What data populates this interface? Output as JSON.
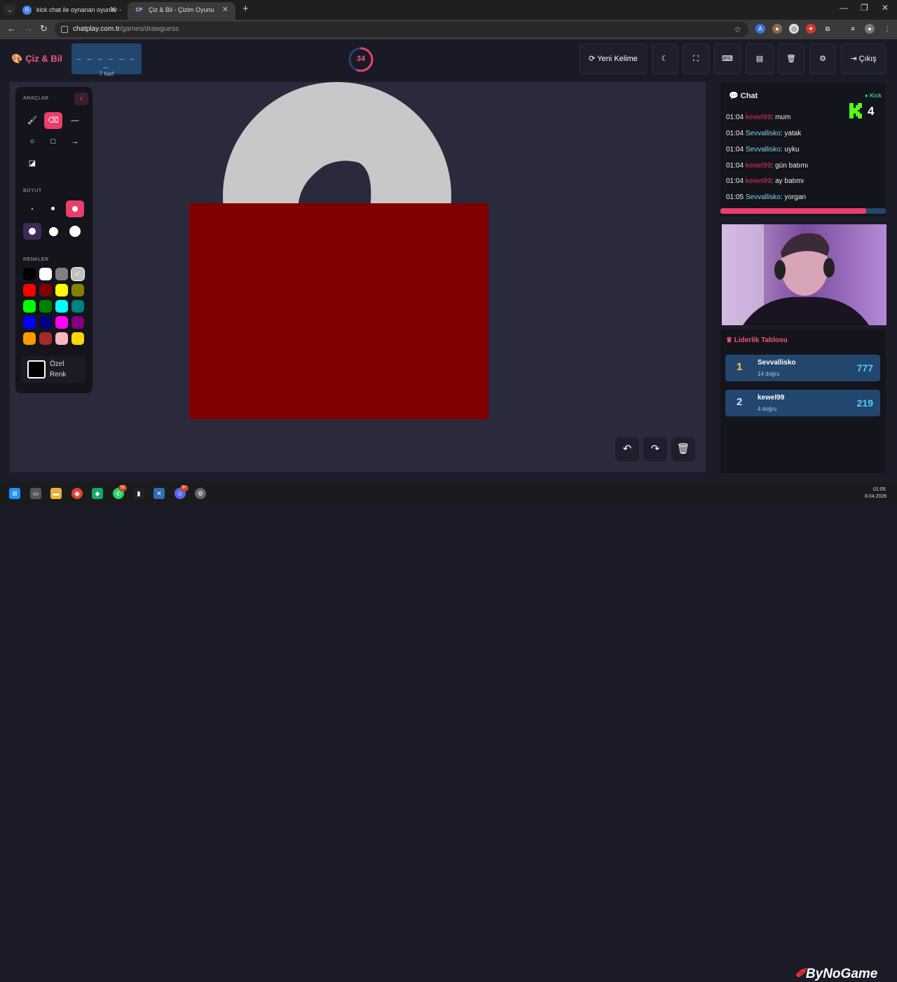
{
  "browser": {
    "tabs": [
      {
        "title": "kick chat ile oynanan oyunlar -",
        "close": "✕"
      },
      {
        "title": "Çiz & Bil - Çizim Oyunu",
        "close": "✕",
        "favicon": "CP"
      }
    ],
    "new_tab": "+",
    "window_controls": [
      "—",
      "❐",
      "✕"
    ],
    "url_host": "chatplay.com.tr",
    "url_path": "/games/drawguess"
  },
  "header": {
    "brand": "Çiz & Bil",
    "word_mask": "_ _ _ _ _ _ _",
    "word_length": "7 harf",
    "timer": "34",
    "timer_progress": 0.55,
    "new_word_label": "Yeni Kelime",
    "exit_label": "Çıkış"
  },
  "tools": {
    "section_tools": "ARAÇLAR",
    "section_size": "BOYUT",
    "section_colors": "RENKLER",
    "custom_color_label": "Özel Renk",
    "palette": [
      "#000000",
      "#ffffff",
      "#808080",
      "#c0c0c0",
      "#ff0000",
      "#800000",
      "#ffff00",
      "#808000",
      "#00ff00",
      "#008000",
      "#00ffff",
      "#008080",
      "#0000ff",
      "#000080",
      "#ff00ff",
      "#800080",
      "#ff9900",
      "#a52a2a",
      "#ffb6c1",
      "#ffd700"
    ],
    "accent": "#ea3f6a"
  },
  "canvas": {
    "background": "#2a2a3c",
    "circle_color": "#c8c8c8",
    "blob_color": "#2a2a3c",
    "rect_color": "#800000"
  },
  "chat": {
    "title": "Chat",
    "source": "Kick",
    "viewer_count": "4",
    "messages": [
      {
        "time": "01:04",
        "user": "kewel99",
        "text": ": mum"
      },
      {
        "time": "01:04",
        "user": "Sevvallisko",
        "text": ": yatak"
      },
      {
        "time": "01:04",
        "user": "Sevvallisko",
        "text": ": uyku"
      },
      {
        "time": "01:04",
        "user": "kewel99",
        "text": ": gün batımı"
      },
      {
        "time": "01:04",
        "user": "kewel99",
        "text": ": ay batımı"
      },
      {
        "time": "01:05",
        "user": "Sevvallisko",
        "text": ": yorgan"
      }
    ]
  },
  "leaderboard": {
    "title": "Liderlik Tablosu",
    "rows": [
      {
        "rank": "1",
        "name": "Sevvallisko",
        "sub": "14 doğru",
        "score": "777"
      },
      {
        "rank": "2",
        "name": "kewel99",
        "sub": "4 doğru",
        "score": "219"
      }
    ]
  },
  "taskbar": {
    "watermark": "ByNoGame",
    "time": "01:05",
    "date": "8.04.2026",
    "badge_whatsapp": "55",
    "badge_discord": "9+"
  }
}
